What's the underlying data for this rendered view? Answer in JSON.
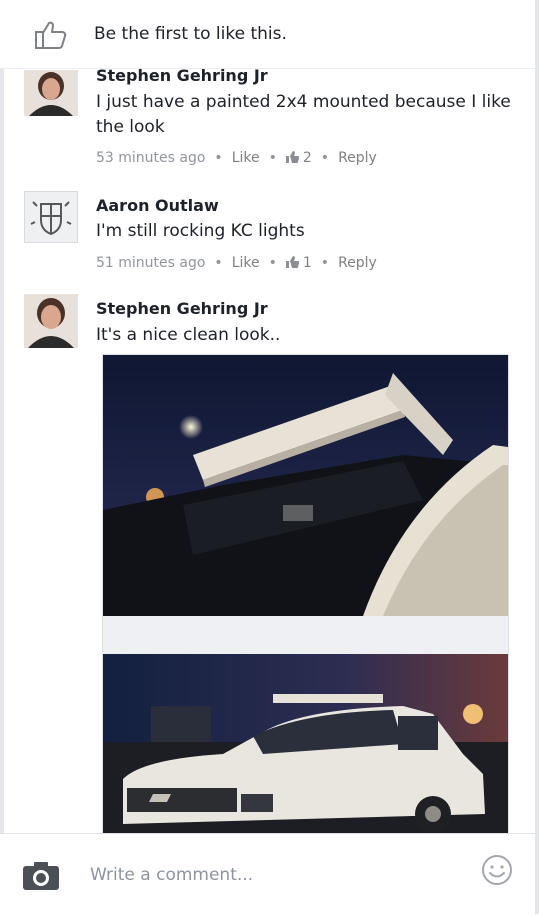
{
  "likes_bar": {
    "text": "Be the first to like this."
  },
  "comments": [
    {
      "author": "Stephen Gehring Jr",
      "text": "I just have a painted 2x4 mounted because I like the look",
      "time": "53 minutes ago",
      "like_label": "Like",
      "like_count": "2",
      "reply_label": "Reply"
    },
    {
      "author": "Aaron Outlaw",
      "text": "I'm still rocking KC lights",
      "time": "51 minutes ago",
      "like_label": "Like",
      "like_count": "1",
      "reply_label": "Reply"
    },
    {
      "author": "Stephen Gehring Jr",
      "text": "It's a nice clean look.."
    }
  ],
  "composer": {
    "placeholder": "Write a comment..."
  },
  "icons": {
    "like": "thumbs-up-icon",
    "camera": "camera-icon",
    "emoji": "smiley-icon"
  },
  "colors": {
    "meta_text": "#90949c",
    "name_text": "#1d2129",
    "placeholder": "#8d949e"
  }
}
